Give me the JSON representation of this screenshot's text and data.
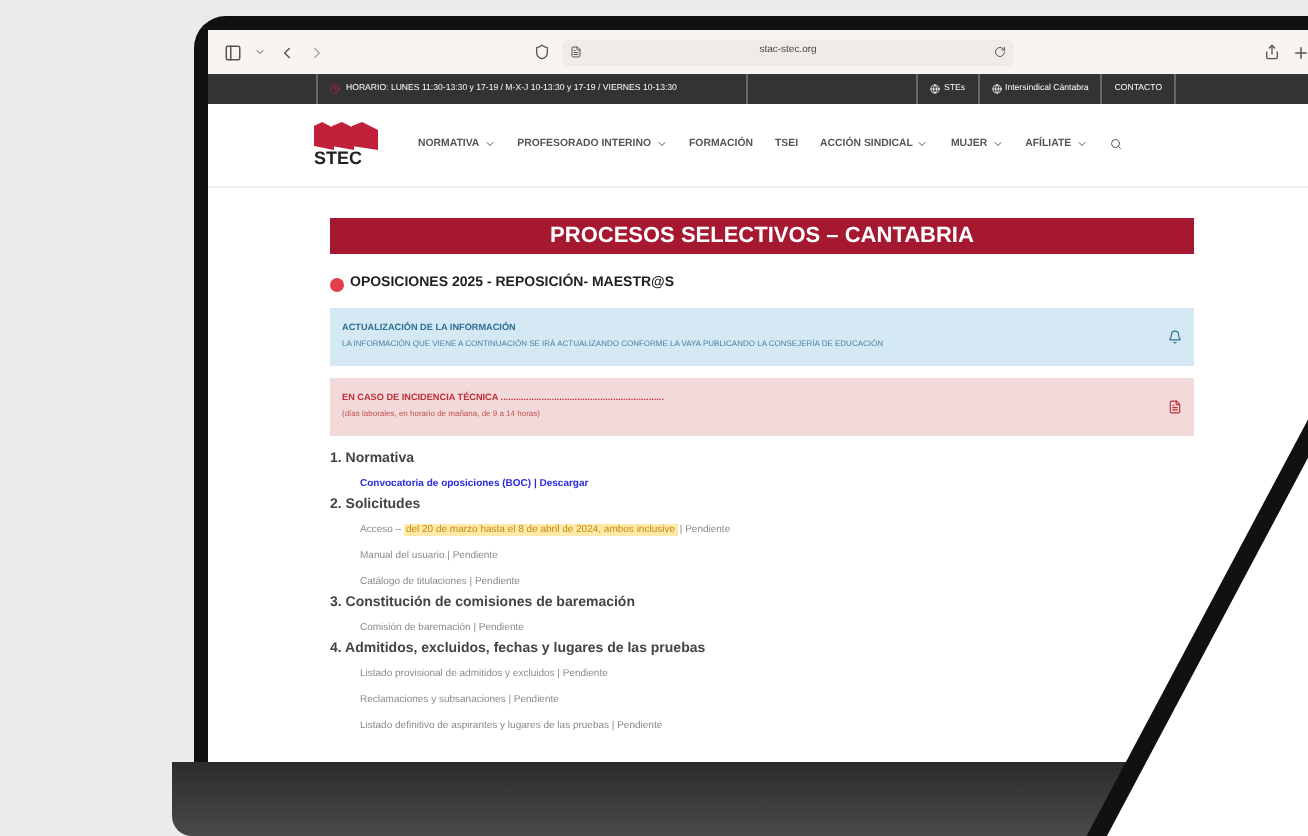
{
  "browser": {
    "url": "stac-stec.org"
  },
  "top_bar": {
    "schedule": "HORARIO: LUNES 11:30-13:30 y 17-19 / M-X-J 10-13:30 y 17-19 / VIERNES 10-13:30",
    "links": [
      "STEs",
      "Intersindical Cántabra",
      "CONTACTO"
    ]
  },
  "logo": {
    "text": "STEC"
  },
  "nav": [
    {
      "label": "NORMATIVA",
      "has_menu": true
    },
    {
      "label": "PROFESORADO INTERINO",
      "has_menu": true
    },
    {
      "label": "FORMACIÓN",
      "has_menu": false
    },
    {
      "label": "TSEI",
      "has_menu": false
    },
    {
      "label": "ACCIÓN SINDICAL",
      "has_menu": true
    },
    {
      "label": "MUJER",
      "has_menu": true
    },
    {
      "label": "AFÍLIATE",
      "has_menu": true
    }
  ],
  "page_title": "PROCESOS SELECTIVOS – CANTABRIA",
  "heading": "OPOSICIONES 2025 - REPOSICIÓN- MAESTR@S",
  "notices": [
    {
      "kind": "info",
      "title": "ACTUALIZACIÓN DE LA INFORMACIÓN",
      "text": "LA INFORMACIÓN QUE VIENE A CONTINUACIÓN SE IRÁ ACTUALIZANDO CONFORME LA VAYA PUBLICANDO LA CONSEJERÍA DE EDUCACIÓN"
    },
    {
      "kind": "alert",
      "title": "EN CASO DE INCIDENCIA TÉCNICA ................................................................",
      "text": "(días laborales, en horario de mañana, de 9 a 14 horas)"
    }
  ],
  "sections": [
    {
      "title": "1. Normativa",
      "items": [
        {
          "kind": "link",
          "text": "Convocatoria de oposiciones (BOC) | Descargar"
        }
      ]
    },
    {
      "title": "2. Solicitudes",
      "items": [
        {
          "kind": "highlighted",
          "before": "Acceso – ",
          "highlight": "del 20 de marzo hasta el 8 de abril de 2024, ambos inclusive",
          "after": " | Pendiente"
        },
        {
          "kind": "plain",
          "text": "Manual del usuario | Pendiente"
        },
        {
          "kind": "plain",
          "text": "Catálogo de titulaciones | Pendiente"
        }
      ]
    },
    {
      "title": "3. Constitución de comisiones de baremación",
      "items": [
        {
          "kind": "plain",
          "text": "Comisión de baremación | Pendiente"
        }
      ]
    },
    {
      "title": "4. Admitidos, excluidos, fechas y lugares de las pruebas",
      "items": [
        {
          "kind": "plain",
          "text": "Listado provisional de admitidos y excluidos | Pendiente"
        },
        {
          "kind": "plain",
          "text": "Reclamaciones y subsanaciones | Pendiente"
        },
        {
          "kind": "plain",
          "text": "Listado definitivo de aspirantes y lugares de las pruebas | Pendiente"
        }
      ]
    }
  ]
}
